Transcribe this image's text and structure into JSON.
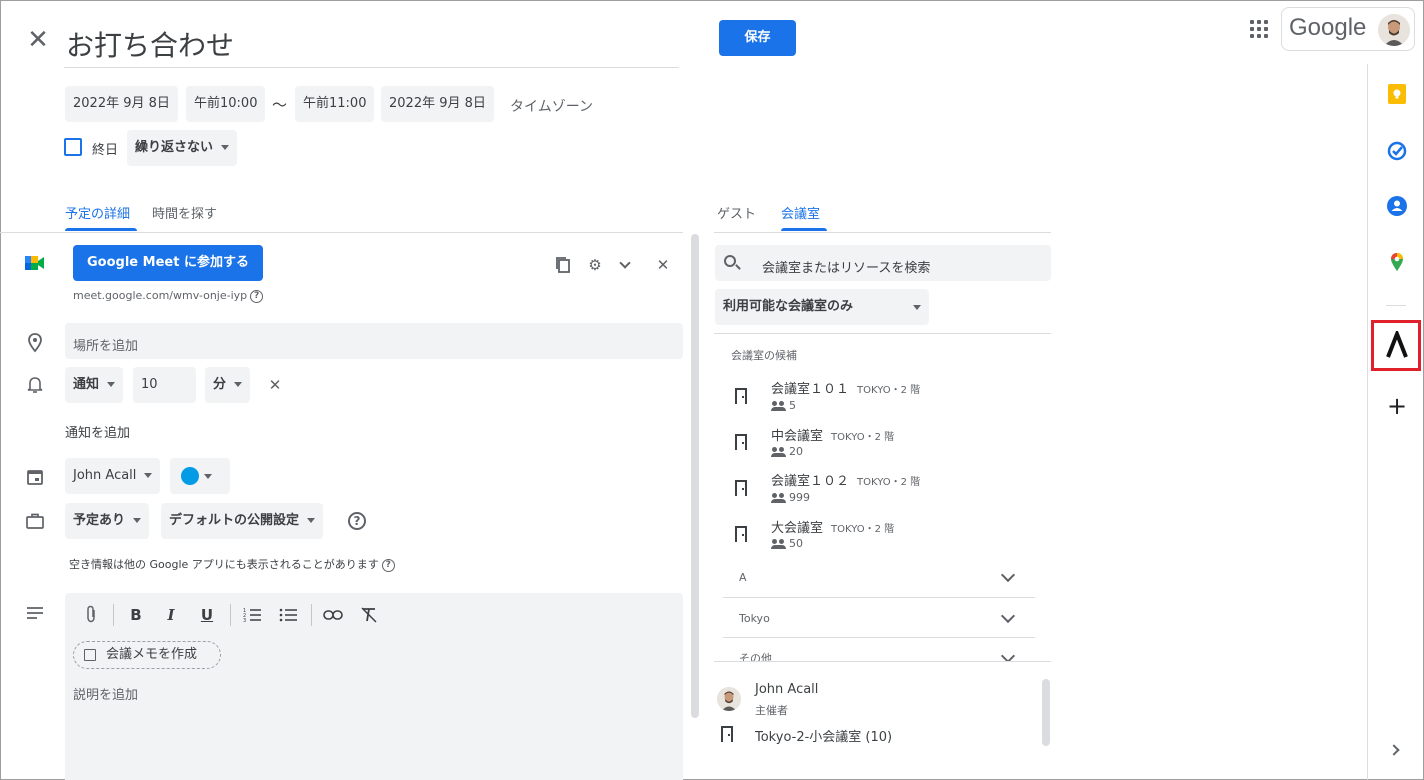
{
  "header": {
    "title": "お打ち合わせ",
    "save_label": "保存",
    "google_label": "Google"
  },
  "datetime": {
    "start_date": "2022年 9月 8日",
    "start_time": "午前10:00",
    "separator": "〜",
    "end_time": "午前11:00",
    "end_date": "2022年 9月 8日",
    "timezone_label": "タイムゾーン",
    "all_day_label": "終日",
    "repeat_label": "繰り返さない"
  },
  "left_tabs": [
    {
      "label": "予定の詳細",
      "active": true
    },
    {
      "label": "時間を探す",
      "active": false
    }
  ],
  "meet": {
    "button_label": "Google Meet に参加する",
    "link": "meet.google.com/wmv-onje-iyp"
  },
  "location": {
    "placeholder": "場所を追加"
  },
  "notification": {
    "type_label": "通知",
    "amount": "10",
    "unit_label": "分",
    "add_label": "通知を追加"
  },
  "calendar": {
    "owner_label": "John Acall",
    "color": "#039be5"
  },
  "visibility": {
    "busy_label": "予定あり",
    "privacy_label": "デフォルトの公開設定",
    "note": "空き情報は他の Google アプリにも表示されることがあります"
  },
  "description": {
    "memo_label": "会議メモを作成",
    "placeholder": "説明を追加"
  },
  "right_tabs": [
    {
      "label": "ゲスト",
      "active": false
    },
    {
      "label": "会議室",
      "active": true
    }
  ],
  "rooms": {
    "search_placeholder": "会議室またはリソースを検索",
    "filter_label": "利用可能な会議室のみ",
    "suggest_header": "会議室の候補",
    "items": [
      {
        "name": "会議室１０１",
        "location": "TOKYO・2 階",
        "capacity": "5"
      },
      {
        "name": "中会議室",
        "location": "TOKYO・2 階",
        "capacity": "20"
      },
      {
        "name": "会議室１０２",
        "location": "TOKYO・2 階",
        "capacity": "999"
      },
      {
        "name": "大会議室",
        "location": "TOKYO・2 階",
        "capacity": "50"
      }
    ],
    "groups": [
      "A",
      "Tokyo",
      "その他"
    ]
  },
  "attendees": [
    {
      "name": "John Acall",
      "role": "主催者"
    },
    {
      "name": "Tokyo-2-小会議室 (10)",
      "role": ""
    }
  ],
  "colors": {
    "accent": "#1a73e8",
    "highlight": "#e0202a",
    "keep": "#fbbc04",
    "tasks": "#1a73e8",
    "contacts": "#1a73e8"
  }
}
